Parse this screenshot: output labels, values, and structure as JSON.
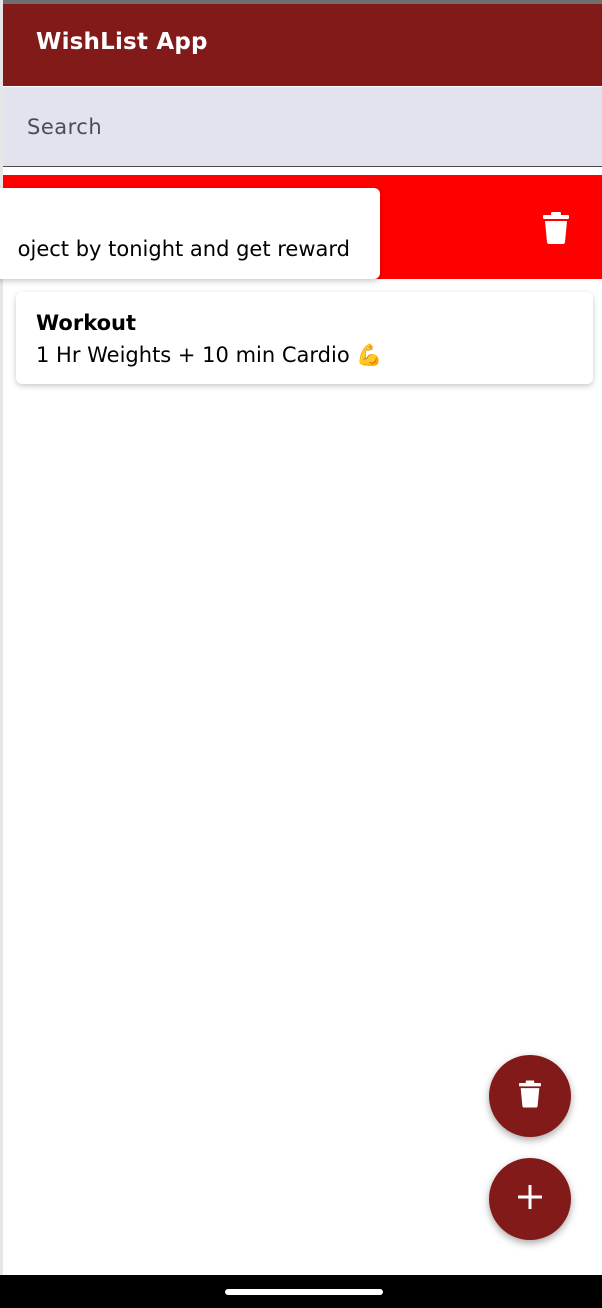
{
  "app_bar": {
    "title": "WishList App",
    "color": "#821a1a"
  },
  "search": {
    "placeholder": "Search"
  },
  "wishes": [
    {
      "title": "",
      "description": "oject by tonight and get reward",
      "state": "swiped-to-delete",
      "swipe_background": "#ff0000",
      "swipe_icon": "trash-icon"
    },
    {
      "title": "Workout",
      "description": "1 Hr Weights + 10 min Cardio 💪"
    }
  ],
  "fab": {
    "delete_icon": "trash-icon",
    "add_icon": "plus-icon",
    "color": "#821a1a"
  }
}
